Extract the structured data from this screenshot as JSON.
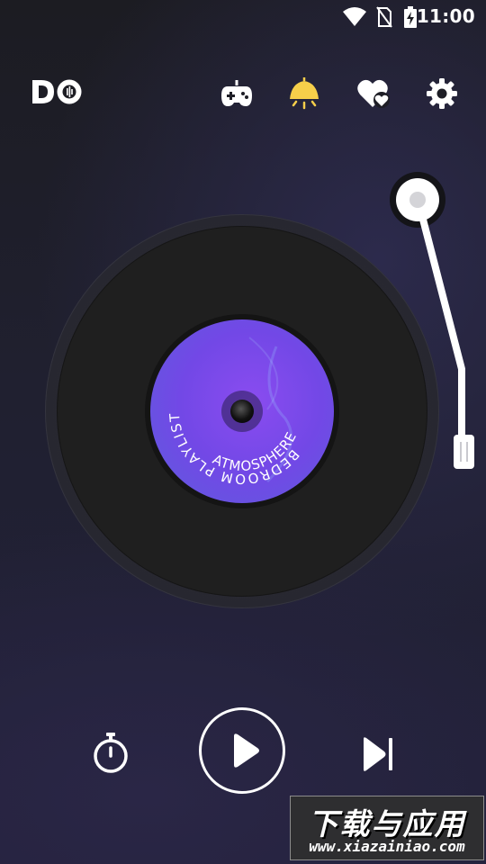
{
  "status_bar": {
    "time": "11:00",
    "icons": [
      "wifi-icon",
      "no-sim-icon",
      "battery-charging-icon"
    ]
  },
  "header": {
    "logo_text": "DO",
    "icons": [
      "gamepad-icon",
      "lamp-icon",
      "heart-icon",
      "settings-icon"
    ],
    "lamp_color": "#f6cf4a"
  },
  "record": {
    "label_top": "BEDROOM PLAYLIST",
    "label_bottom": "ATMOSPHERE",
    "label_color": "#7a4ae8"
  },
  "controls": {
    "icons": [
      "timer-icon",
      "play-icon",
      "skip-next-icon"
    ]
  },
  "watermark": {
    "title": "下载与应用",
    "url": "www.xiazainiao.com"
  }
}
